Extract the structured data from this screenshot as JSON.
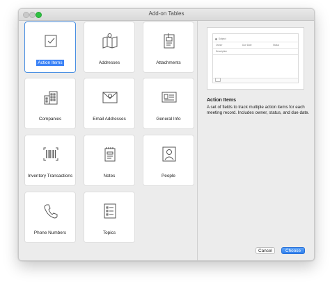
{
  "window": {
    "title": "Add-on Tables"
  },
  "tiles": [
    {
      "label": "Action Items",
      "icon": "checkbox-icon",
      "selected": true
    },
    {
      "label": "Addresses",
      "icon": "map-icon",
      "selected": false
    },
    {
      "label": "Attachments",
      "icon": "clipboard-icon",
      "selected": false
    },
    {
      "label": "Companies",
      "icon": "building-icon",
      "selected": false
    },
    {
      "label": "Email Addresses",
      "icon": "envelope-icon",
      "selected": false
    },
    {
      "label": "General Info",
      "icon": "id-card-icon",
      "selected": false
    },
    {
      "label": "Inventory Transactions",
      "icon": "barcode-icon",
      "selected": false
    },
    {
      "label": "Notes",
      "icon": "notepad-icon",
      "selected": false
    },
    {
      "label": "People",
      "icon": "person-icon",
      "selected": false
    },
    {
      "label": "Phone Numbers",
      "icon": "phone-icon",
      "selected": false
    },
    {
      "label": "Topics",
      "icon": "list-icon",
      "selected": false
    }
  ],
  "preview": {
    "subject_label": "Subject",
    "owner_label": "Owner",
    "due_date_label": "Due Date",
    "status_label": "Status",
    "description_label": "Description"
  },
  "detail": {
    "title": "Action Items",
    "description": "A set of fields to track multiple action items for each meeting record. Includes owner, status, and due date."
  },
  "buttons": {
    "cancel": "Cancel",
    "choose": "Choose"
  },
  "colors": {
    "accent": "#3b82f6",
    "window_bg": "#ececec"
  }
}
